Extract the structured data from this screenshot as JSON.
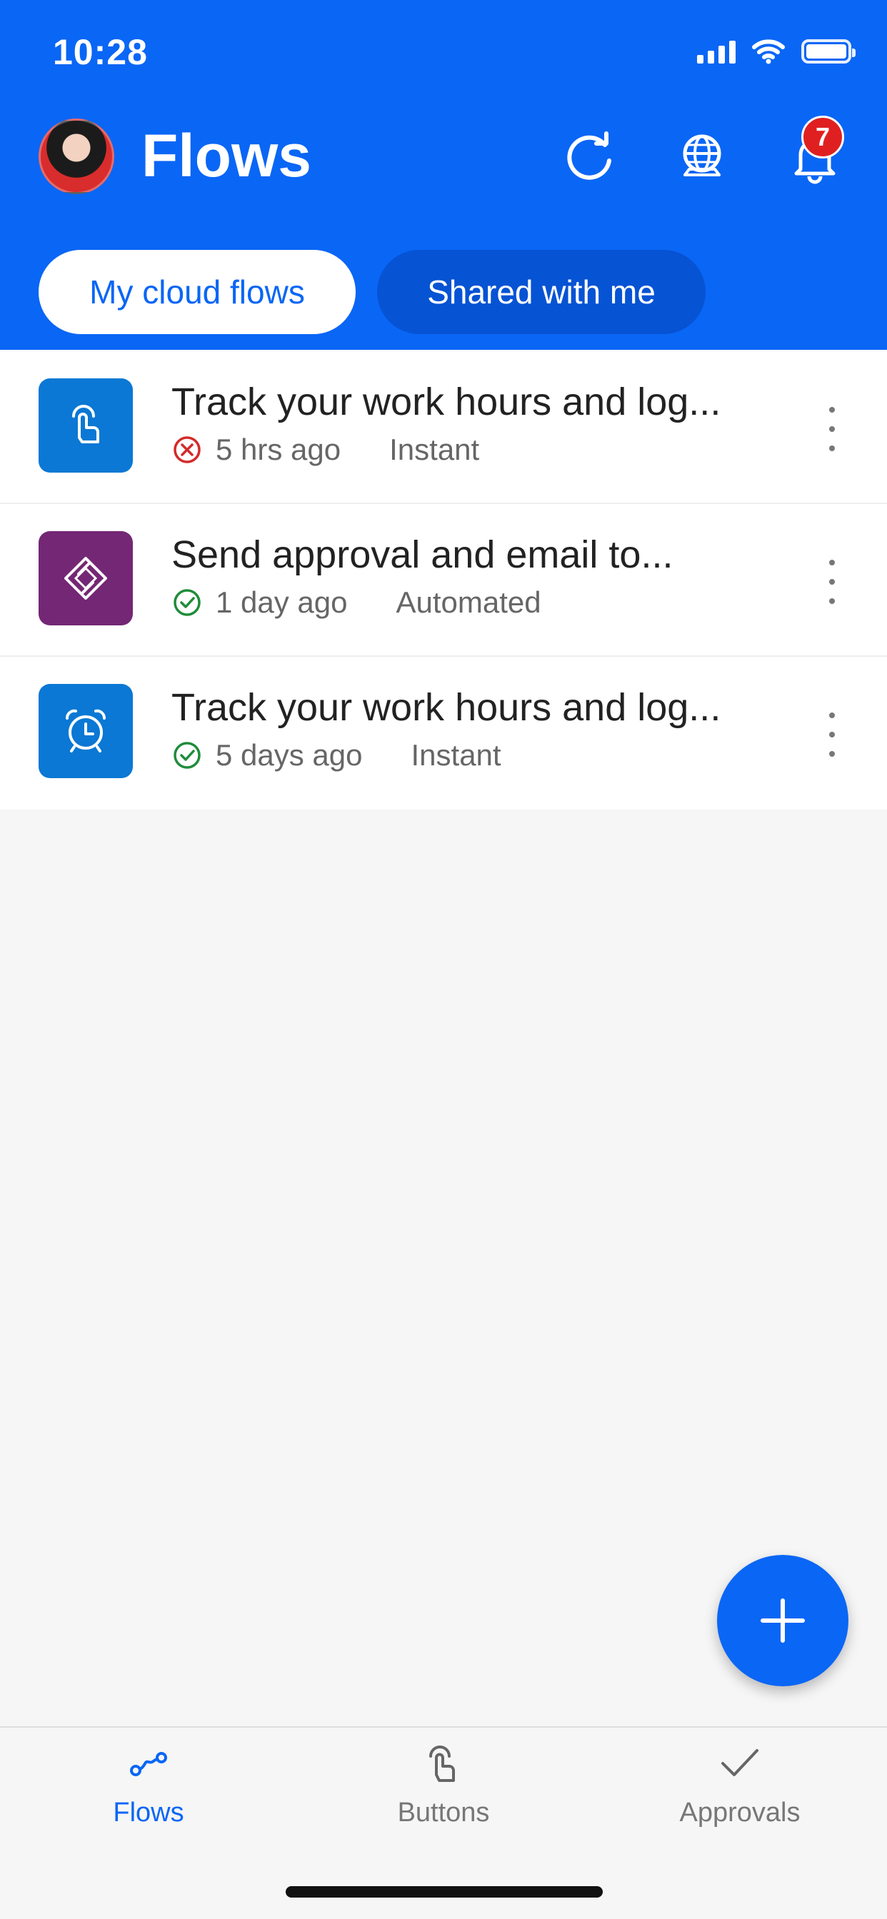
{
  "status_bar": {
    "time": "10:28"
  },
  "header": {
    "title": "Flows",
    "notification_count": "7",
    "icons": [
      "refresh-icon",
      "globe-icon",
      "bell-icon"
    ]
  },
  "tabs": [
    {
      "label": "My cloud flows",
      "active": true
    },
    {
      "label": "Shared with me",
      "active": false
    }
  ],
  "flows": [
    {
      "title": "Track your work hours and log...",
      "status": "failed",
      "time": "5 hrs ago",
      "type": "Instant",
      "icon": "touch-icon",
      "icon_color": "#0a78d4"
    },
    {
      "title": "Send approval and email to...",
      "status": "succeeded",
      "time": "1 day ago",
      "type": "Automated",
      "icon": "powerapps-icon",
      "icon_color": "#742774"
    },
    {
      "title": "Track your work hours and log...",
      "status": "succeeded",
      "time": "5 days ago",
      "type": "Instant",
      "icon": "alarm-clock-icon",
      "icon_color": "#0a78d4"
    }
  ],
  "bottom_nav": [
    {
      "label": "Flows",
      "active": true,
      "icon": "flows-icon"
    },
    {
      "label": "Buttons",
      "active": false,
      "icon": "touch-icon"
    },
    {
      "label": "Approvals",
      "active": false,
      "icon": "checkmark-icon"
    }
  ],
  "colors": {
    "brand": "#0a66f5",
    "error": "#d42a2a",
    "success": "#1f8c3a"
  }
}
